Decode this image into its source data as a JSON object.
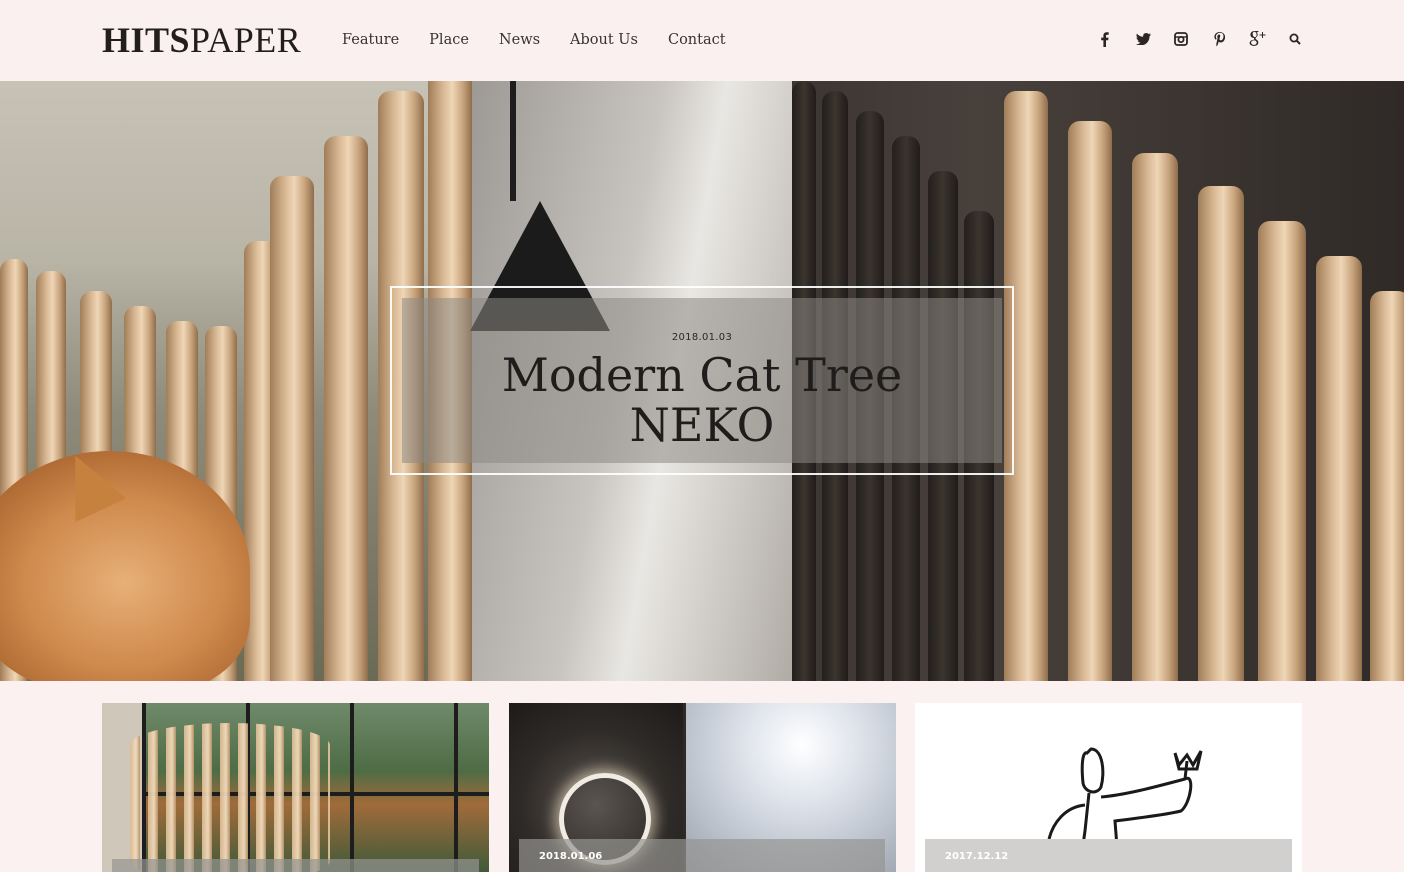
{
  "header": {
    "logo_bold": "HITS",
    "logo_light": "PAPER",
    "nav": [
      {
        "label": "Feature"
      },
      {
        "label": "Place"
      },
      {
        "label": "News"
      },
      {
        "label": "About Us"
      },
      {
        "label": "Contact"
      }
    ],
    "social_icons": [
      "facebook-icon",
      "twitter-icon",
      "instagram-icon",
      "pinterest-icon",
      "google-plus-icon",
      "search-icon"
    ]
  },
  "hero": {
    "date": "2018.01.03",
    "title_line1": "Modern Cat Tree",
    "title_line2": "NEKO"
  },
  "cards": [
    {
      "date": ""
    },
    {
      "date": "2018.01.06"
    },
    {
      "date": "2017.12.12"
    }
  ],
  "colors": {
    "page_background": "#fbf1f1",
    "text": "#2a2424",
    "card_overlay": "#969492"
  }
}
